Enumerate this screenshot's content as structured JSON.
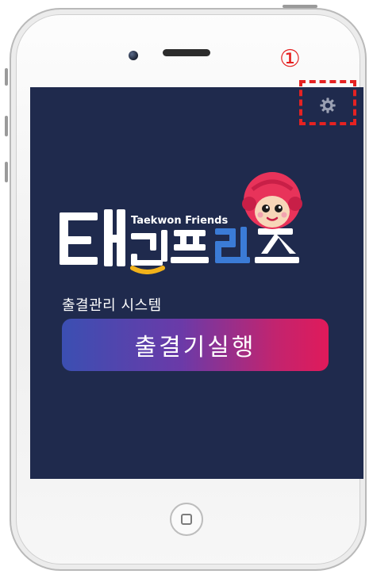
{
  "screen": {
    "annotation_marker": "①",
    "logo": {
      "english_text": "Taekwon Friends",
      "korean_text": "태권프렌즈"
    },
    "subtitle": "출결관리 시스템",
    "run_button_label": "출결기실행"
  },
  "colors": {
    "screen_bg": "#1f2a4d",
    "annotation": "#e52222",
    "button_gradient": [
      "#3b4fb2",
      "#6b3aa8",
      "#c2246f",
      "#e01a5a"
    ],
    "logo_yellow": "#f2b21a",
    "logo_blue": "#3b7bd6",
    "mascot_red": "#e8335a"
  },
  "icons": [
    "gear-icon",
    "mascot-icon",
    "home-button-icon"
  ]
}
